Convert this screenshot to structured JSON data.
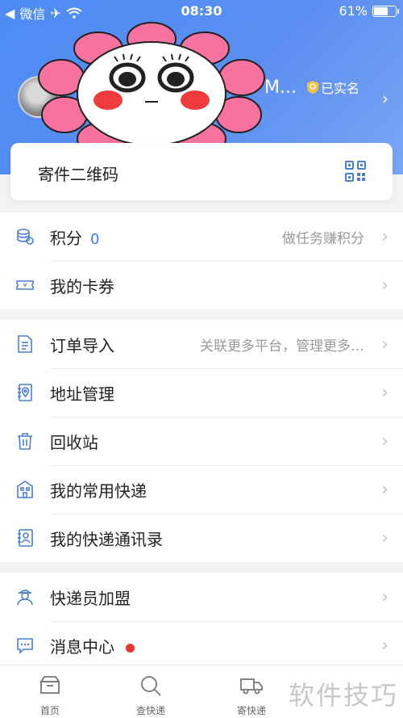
{
  "status_bar": {
    "carrier": "微信",
    "time": "08:30",
    "battery": "61%",
    "battery_level": 0.61
  },
  "profile": {
    "username_tail": "M...",
    "verified_label": "已实名"
  },
  "qr_card": {
    "title": "寄件二维码"
  },
  "section1": [
    {
      "label": "积分",
      "count": "0",
      "hint": "做任务赚积分"
    },
    {
      "label": "我的卡券"
    }
  ],
  "section2": [
    {
      "label": "订单导入",
      "hint": "关联更多平台，管理更多…"
    },
    {
      "label": "地址管理"
    },
    {
      "label": "回收站"
    },
    {
      "label": "我的常用快递"
    },
    {
      "label": "我的快递通讯录"
    }
  ],
  "section3": [
    {
      "label": "快递员加盟"
    },
    {
      "label": "消息中心"
    }
  ],
  "tabs": [
    {
      "label": "首页"
    },
    {
      "label": "查快递"
    },
    {
      "label": "寄快递"
    }
  ],
  "watermark": "软件技巧",
  "colors": {
    "header_blue": "#4d8cf5",
    "accent": "#3a7af2",
    "icon_blue": "#4a7fd6",
    "badge_red": "#e53935"
  }
}
